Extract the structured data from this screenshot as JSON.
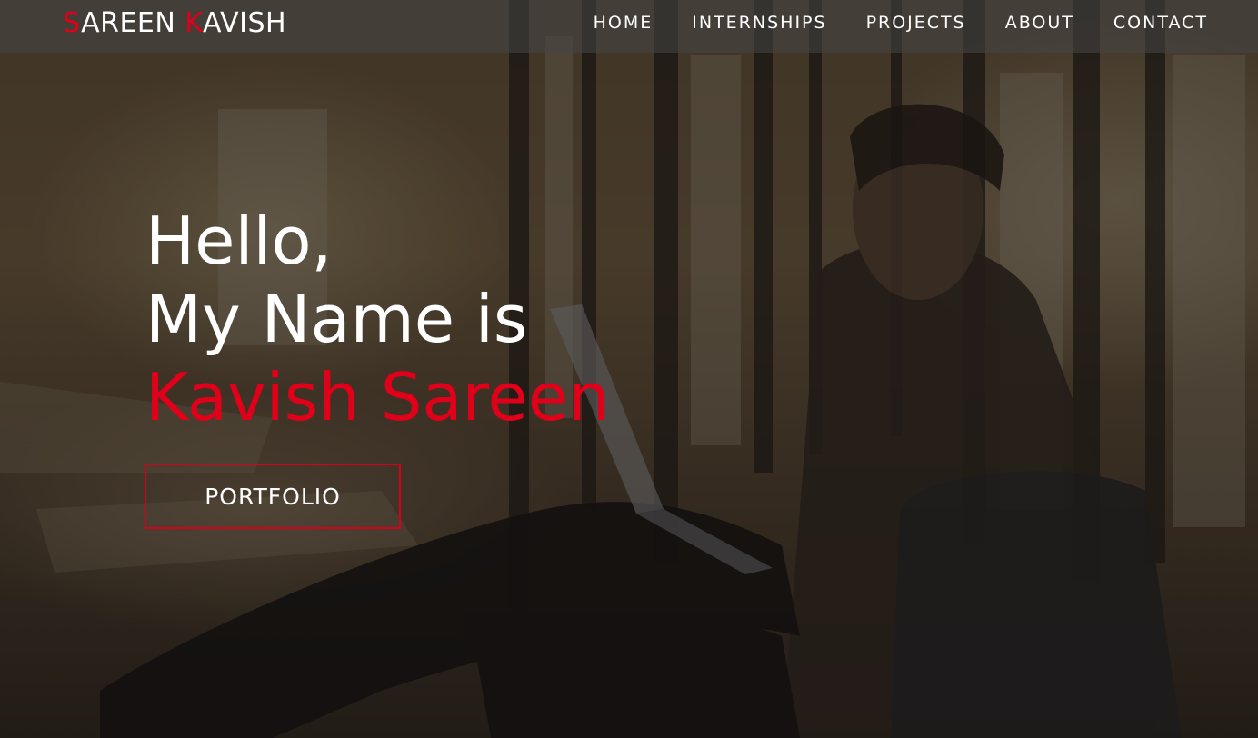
{
  "brand": {
    "first_initial": "S",
    "first_rest": "AREEN ",
    "last_initial": "K",
    "last_rest": "AVISH"
  },
  "nav": {
    "items": [
      {
        "label": "HOME"
      },
      {
        "label": "INTERNSHIPS"
      },
      {
        "label": "PROJECTS"
      },
      {
        "label": "ABOUT"
      },
      {
        "label": "CONTACT"
      }
    ]
  },
  "hero": {
    "greeting": "Hello,",
    "intro": "My Name is",
    "name": "Kavish Sareen",
    "button_label": "PORTFOLIO"
  },
  "colors": {
    "accent": "#e0001a",
    "text": "#ffffff",
    "navbar_bg": "#464646"
  }
}
